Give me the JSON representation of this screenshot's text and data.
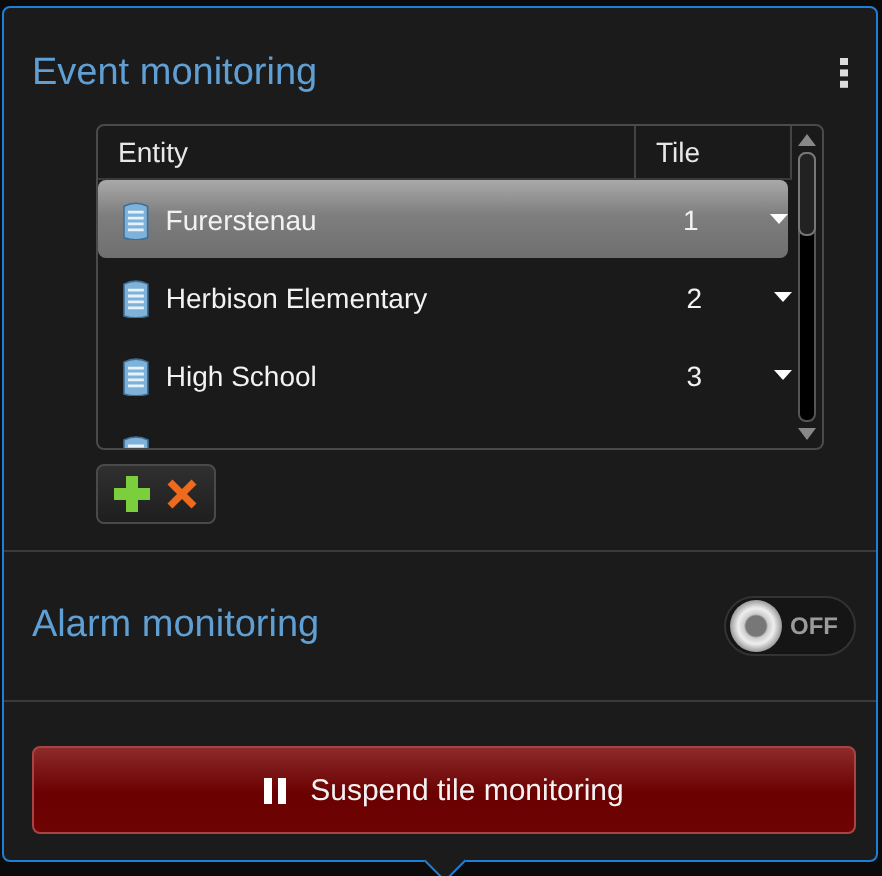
{
  "event_monitoring": {
    "title": "Event monitoring",
    "table": {
      "columns": [
        "Entity",
        "Tile"
      ],
      "rows": [
        {
          "entity": "Furerstenau",
          "tile": "1",
          "selected": true
        },
        {
          "entity": "Herbison Elementary",
          "tile": "2",
          "selected": false
        },
        {
          "entity": "High School",
          "tile": "3",
          "selected": false
        }
      ]
    }
  },
  "alarm_monitoring": {
    "title": "Alarm monitoring",
    "toggle": {
      "on": false,
      "label": "OFF"
    }
  },
  "suspend_button": {
    "label": "Suspend tile monitoring"
  }
}
